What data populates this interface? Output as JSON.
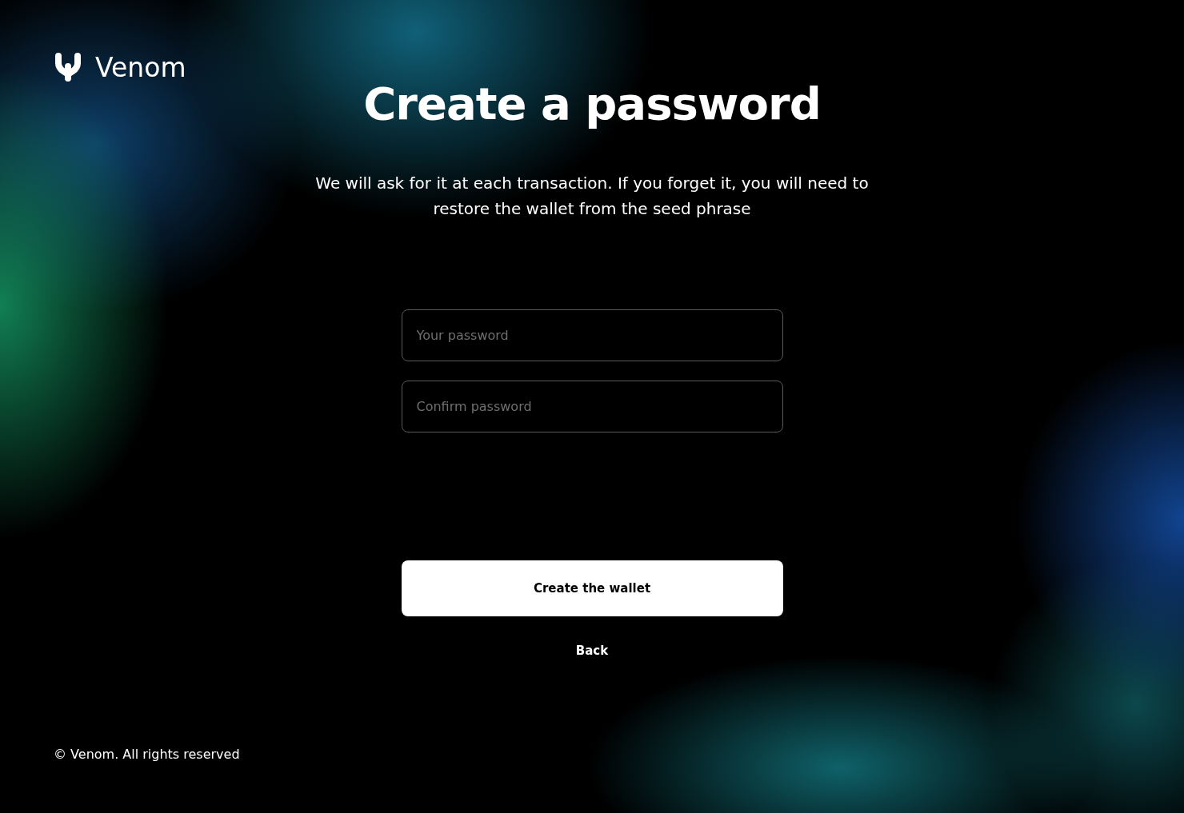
{
  "brand": {
    "name": "Venom"
  },
  "title": "Create a password",
  "subtitle": "We will ask for it at each transaction. If you forget it, you will need to restore the wallet from the seed phrase",
  "fields": [
    {
      "placeholder": "Your password"
    },
    {
      "placeholder": "Confirm password"
    }
  ],
  "primary_button": "Create the wallet",
  "back_link": "Back",
  "footer": "© Venom. All rights reserved"
}
